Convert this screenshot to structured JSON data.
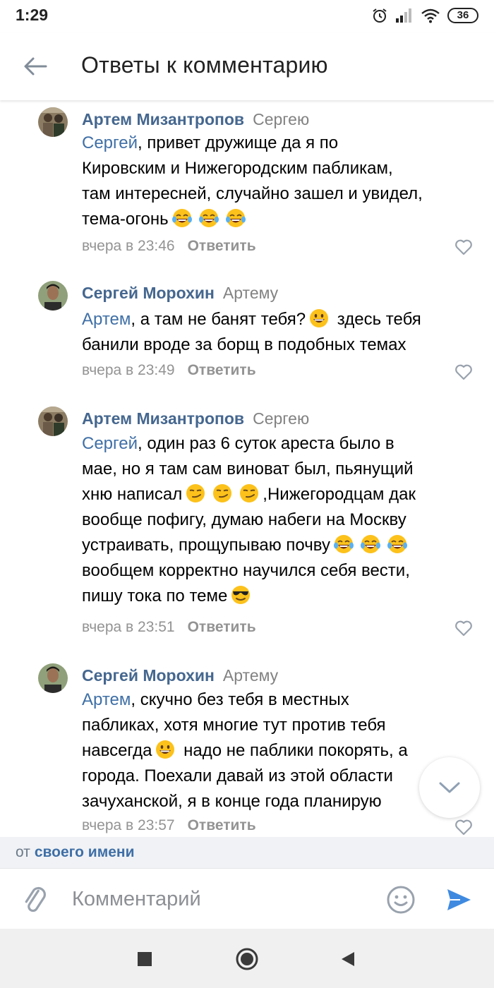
{
  "status_bar": {
    "time": "1:29",
    "battery": "36",
    "icons": [
      "alarm-icon",
      "signal-icon",
      "wifi-icon",
      "battery-icon"
    ]
  },
  "header": {
    "title": "Ответы к комментарию",
    "back_icon": "arrow-left-icon"
  },
  "comments": [
    {
      "author": "Артем Мизантропов",
      "reply_to": "Сергею",
      "mention": "Сергей",
      "lines": [
        ", привет дружище да я по",
        "Кировским и Нижегородским пабликам,",
        "там интересней, случайно зашел и увидел,",
        "тема-огонь"
      ],
      "time": "вчера в 23:46",
      "reply_label": "Ответить"
    },
    {
      "author": "Сергей Морохин",
      "reply_to": "Артему",
      "mention": "Артем",
      "lines": [
        ", а там не банят тебя?",
        " здесь тебя",
        "банили вроде за борщ в подобных темах"
      ],
      "time": "вчера в 23:49",
      "reply_label": "Ответить"
    },
    {
      "author": "Артем Мизантропов",
      "reply_to": "Сергею",
      "mention": "Сергей",
      "lines": [
        ", один раз 6 суток ареста было в",
        "мае, но я там сам виноват был, пьянущий",
        "хню написал",
        ",Нижегородцам дак",
        "вообще пофигу, думаю набеги на Москву",
        "устраивать, прощупываю почву",
        "вообщем корректно научился себя вести,",
        "пишу тока по теме"
      ],
      "time": "вчера в 23:51",
      "reply_label": "Ответить"
    },
    {
      "author": "Сергей Морохин",
      "reply_to": "Артему",
      "mention": "Артем",
      "lines": [
        ", скучно без тебя в местных",
        "пабликах, хотя многие тут против тебя",
        "навсегда",
        " надо не паблики покорять, а",
        "города. Поехали давай из этой области",
        "зачуханской, я в конце года планирую"
      ],
      "time": "вчера в 23:57",
      "reply_label": "Ответить"
    }
  ],
  "from_bar": {
    "prefix": "от",
    "name": "своего имени"
  },
  "input": {
    "placeholder": "Комментарий"
  },
  "colors": {
    "author": "#45678f",
    "mention": "#3f6fa6",
    "meta": "#939393",
    "send": "#3f8ae0"
  }
}
